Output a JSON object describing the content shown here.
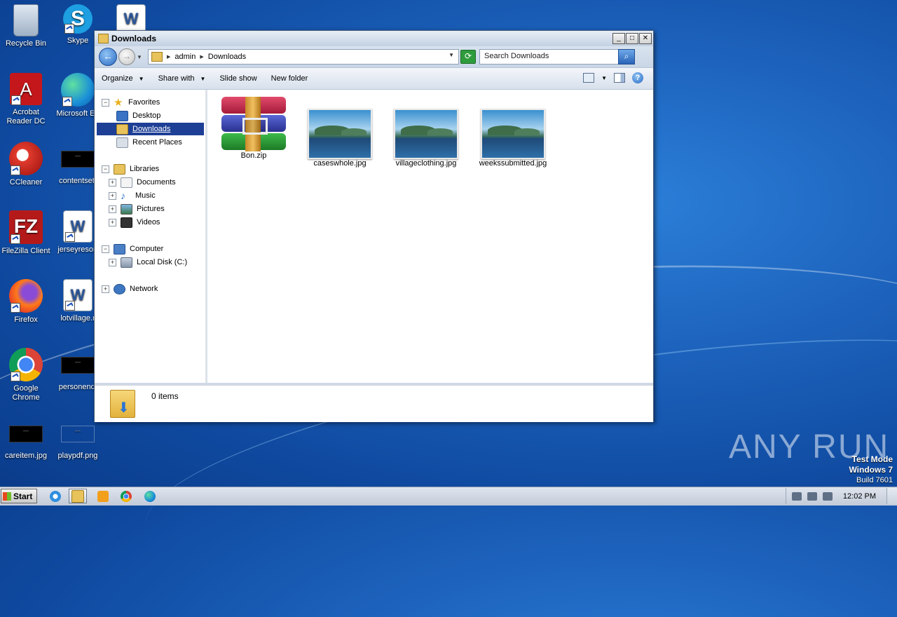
{
  "desktop": {
    "icons": [
      {
        "label": "Recycle Bin"
      },
      {
        "label": "Skype"
      },
      {
        "label": "Acrobat Reader DC"
      },
      {
        "label": "Microsoft Ed"
      },
      {
        "label": "CCleaner"
      },
      {
        "label": "contentsett"
      },
      {
        "label": "FileZilla Client"
      },
      {
        "label": "jerseyresort"
      },
      {
        "label": "Firefox"
      },
      {
        "label": "lotvillage.r"
      },
      {
        "label": "Google Chrome"
      },
      {
        "label": "personendi"
      },
      {
        "label": "careitem.jpg"
      },
      {
        "label": "playpdf.png"
      }
    ]
  },
  "window": {
    "title": "Downloads",
    "buttons": {
      "minimize": "_",
      "maximize": "□",
      "close": "✕"
    },
    "address": {
      "crumbs": [
        "admin",
        "Downloads"
      ]
    },
    "search": {
      "placeholder": "Search Downloads"
    },
    "toolbar": {
      "organize": "Organize",
      "share_with": "Share with",
      "slide_show": "Slide show",
      "new_folder": "New folder"
    },
    "nav": {
      "favorites": "Favorites",
      "desktop": "Desktop",
      "downloads": "Downloads",
      "recent_places": "Recent Places",
      "libraries": "Libraries",
      "documents": "Documents",
      "music": "Music",
      "pictures": "Pictures",
      "videos": "Videos",
      "computer": "Computer",
      "local_disk": "Local Disk (C:)",
      "network": "Network"
    },
    "files": [
      {
        "name": "Bon.zip",
        "type": "zip"
      },
      {
        "name": "caseswhole.jpg",
        "type": "jpg"
      },
      {
        "name": "villageclothing.jpg",
        "type": "jpg"
      },
      {
        "name": "weekssubmitted.jpg",
        "type": "jpg"
      }
    ],
    "details": {
      "item_count": "0 items"
    }
  },
  "watermark": {
    "text": "ANY RUN"
  },
  "system": {
    "test_mode": "Test Mode",
    "os": "Windows 7",
    "build": "Build 7601",
    "clock": "12:02 PM"
  },
  "taskbar": {
    "start": "Start"
  },
  "icons": [
    "recycle-bin-icon",
    "skype-icon",
    "acrobat-icon",
    "edge-icon",
    "ccleaner-icon",
    "filezilla-icon",
    "firefox-icon",
    "chrome-icon",
    "word-doc-icon",
    "folder-icon",
    "search-icon",
    "help-icon",
    "refresh-icon"
  ],
  "colors": {
    "selection": "#1e3f96",
    "desktop_blue": "#1d63bd"
  }
}
